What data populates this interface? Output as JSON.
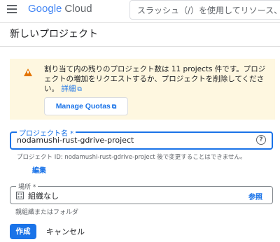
{
  "header": {
    "logo_google": "Google",
    "logo_cloud": "Cloud",
    "search_placeholder": "スラッシュ（/）を使用してリソース、ドキ"
  },
  "page": {
    "title": "新しいプロジェクト"
  },
  "notice": {
    "text": "割り当て内の残りのプロジェクト数は 11 projects 件です。プロジェクトの増加をリクエストするか、プロジェクトを削除してください。",
    "detail_link": "詳細",
    "button_label": "Manage Quotas"
  },
  "project_name": {
    "label": "プロジェクト名 *",
    "value": "nodamushi-rust-gdrive-project",
    "project_id_text": "プロジェクト ID: nodamushi-rust-gdrive-project 後で変更することはできません。",
    "edit_link": "編集"
  },
  "location": {
    "label": "場所 *",
    "value": "組織なし",
    "browse_link": "参照",
    "help_text": "親組織またはフォルダ"
  },
  "actions": {
    "create": "作成",
    "cancel": "キャンセル"
  },
  "icons": [
    "menu-icon",
    "warning-icon",
    "external-link-icon",
    "help-icon",
    "organization-icon"
  ],
  "colors": {
    "accent": "#1a73e8",
    "warning_bg": "#fef7e0",
    "warning_icon": "#e37400"
  }
}
